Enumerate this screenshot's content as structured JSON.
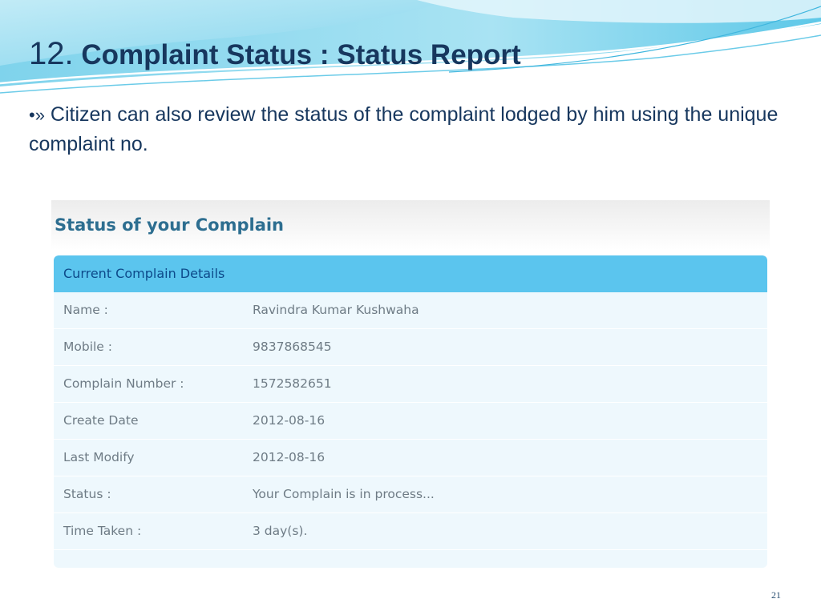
{
  "slide": {
    "title_number": "12.",
    "title_text": "Complaint Status : Status Report",
    "bullet_marker": "•»",
    "bullet_text": "Citizen can also review the status of the complaint lodged by him using the unique complaint no.",
    "page_number": "21"
  },
  "panel": {
    "title": "Status of your Complain",
    "section_title": "Current Complain Details",
    "rows": [
      {
        "label": "Name :",
        "value": "Ravindra Kumar Kushwaha"
      },
      {
        "label": "Mobile :",
        "value": "9837868545"
      },
      {
        "label": "Complain Number :",
        "value": "1572582651"
      },
      {
        "label": "Create Date",
        "value": "2012-08-16"
      },
      {
        "label": "Last Modify",
        "value": "2012-08-16"
      },
      {
        "label": "Status :",
        "value": "Your Complain is in process..."
      },
      {
        "label": "Time Taken :",
        "value": "3 day(s)."
      }
    ]
  },
  "colors": {
    "title_text": "#17375e",
    "panel_title": "#2d6e90",
    "section_header_bg": "#5bc5ee",
    "section_header_text": "#0d4a8a",
    "rows_bg": "#eef8fd",
    "row_text": "#6e7b85"
  }
}
